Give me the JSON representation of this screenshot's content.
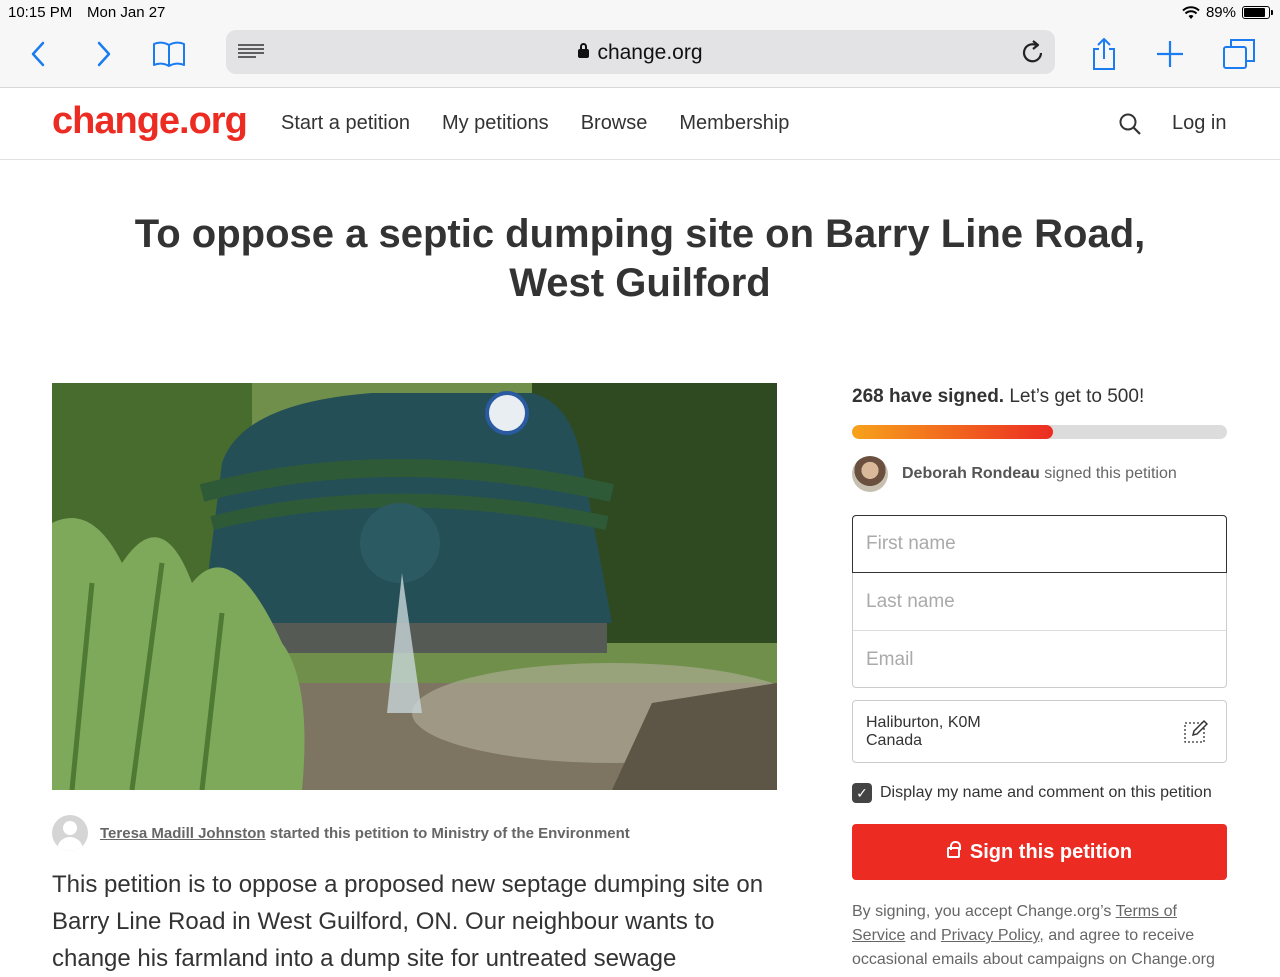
{
  "status_bar": {
    "time": "10:15 PM",
    "date": "Mon Jan 27",
    "battery": "89%"
  },
  "browser": {
    "url": "change.org"
  },
  "site": {
    "logo": "change.org",
    "nav": [
      "Start a petition",
      "My petitions",
      "Browse",
      "Membership"
    ],
    "login": "Log in"
  },
  "petition": {
    "title": "To oppose a septic dumping site on Barry Line Road, West Guilford",
    "author_name": "Teresa Madill Johnston",
    "author_suffix": " started this petition to Ministry of the Environment",
    "body": "This petition is to oppose a proposed new septage dumping site on Barry Line Road in West Guilford, ON. Our neighbour wants to change his farmland into a dump site for untreated sewage"
  },
  "sidebar": {
    "signed_count": "268 have signed.",
    "signed_goal": " Let’s get to 500!",
    "progress_fraction": 0.536,
    "recent_signer": "Deborah Rondeau",
    "recent_suffix": " signed this petition",
    "first_name_placeholder": "First name",
    "last_name_placeholder": "Last name",
    "email_placeholder": "Email",
    "location_line1": "Haliburton, K0M",
    "location_line2": "Canada",
    "display_label": "Display my name and comment on this petition",
    "sign_button": "Sign this petition",
    "legal_prefix": "By signing, you accept Change.org’s ",
    "legal_terms": "Terms of Service",
    "legal_and": " and ",
    "legal_privacy": "Privacy Policy",
    "legal_suffix": ", and agree to receive occasional emails about campaigns on Change.org"
  },
  "colors": {
    "brand": "#ec2c22",
    "ios_blue": "#1a7cf0"
  }
}
